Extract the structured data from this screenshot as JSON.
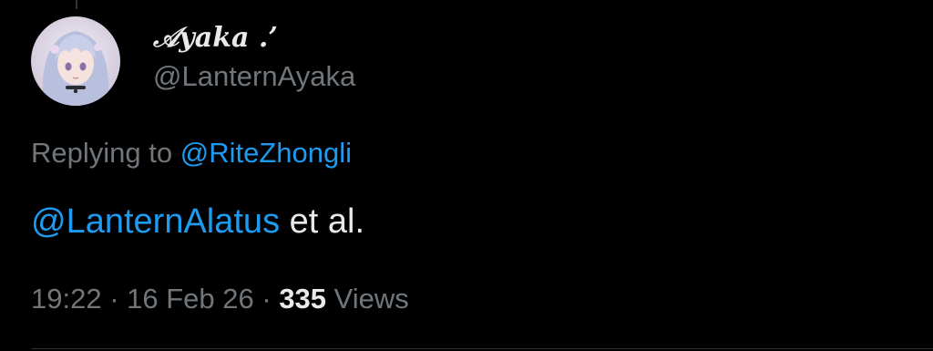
{
  "author": {
    "display_name": "𝒜yaka .’",
    "handle": "@LanternAyaka",
    "avatar_icon": "profile-avatar"
  },
  "reply": {
    "prefix": "Replying to ",
    "to_handle": "@RiteZhongli"
  },
  "tweet": {
    "mention": "@LanternAlatus",
    "text": " et al."
  },
  "meta": {
    "time": "19:22",
    "separator": " · ",
    "date": "16 Feb 26",
    "views_count": "335",
    "views_label": " Views"
  },
  "colors": {
    "background": "#000000",
    "primary_text": "#e7e9ea",
    "secondary_text": "#71767b",
    "link": "#1d9bf0"
  }
}
